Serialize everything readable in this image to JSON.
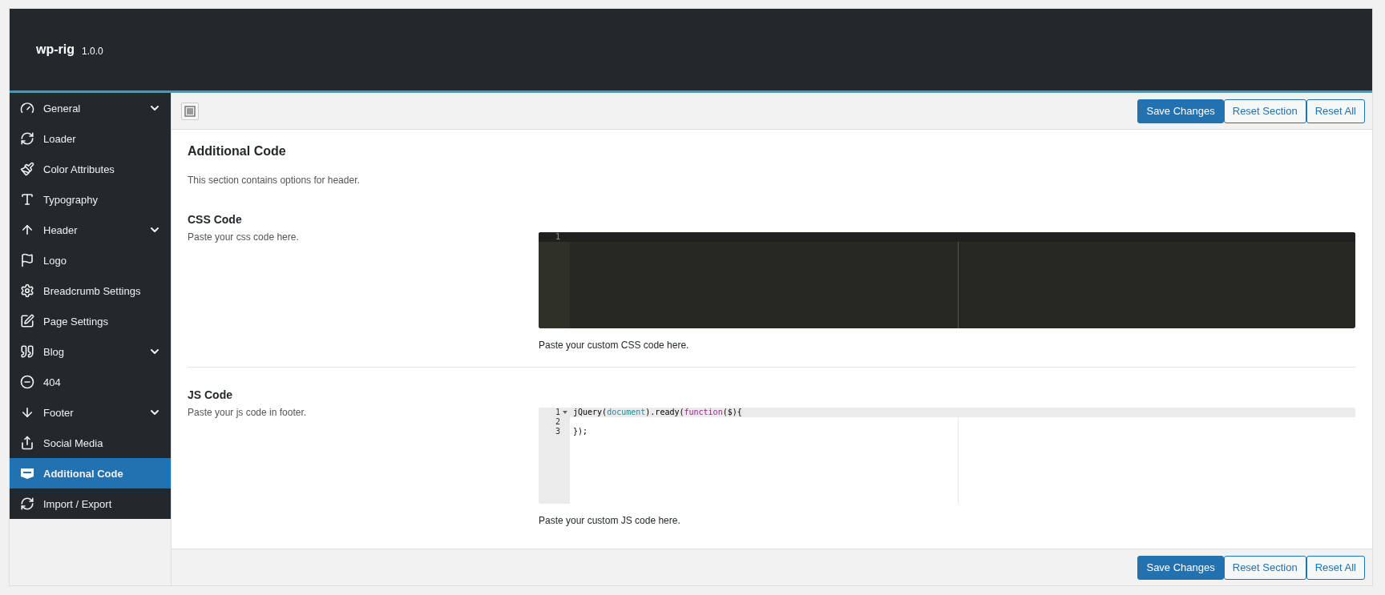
{
  "header": {
    "title": "wp-rig",
    "version": "1.0.0"
  },
  "sidebar": {
    "items": [
      {
        "label": "General",
        "expandable": true,
        "selected": false
      },
      {
        "label": "Loader",
        "expandable": false,
        "selected": false
      },
      {
        "label": "Color Attributes",
        "expandable": false,
        "selected": false
      },
      {
        "label": "Typography",
        "expandable": false,
        "selected": false
      },
      {
        "label": "Header",
        "expandable": true,
        "selected": false
      },
      {
        "label": "Logo",
        "expandable": false,
        "selected": false
      },
      {
        "label": "Breadcrumb Settings",
        "expandable": false,
        "selected": false
      },
      {
        "label": "Page Settings",
        "expandable": false,
        "selected": false
      },
      {
        "label": "Blog",
        "expandable": true,
        "selected": false
      },
      {
        "label": "404",
        "expandable": false,
        "selected": false
      },
      {
        "label": "Footer",
        "expandable": true,
        "selected": false
      },
      {
        "label": "Social Media",
        "expandable": false,
        "selected": false
      },
      {
        "label": "Additional Code",
        "expandable": false,
        "selected": true
      },
      {
        "label": "Import / Export",
        "expandable": false,
        "selected": false
      }
    ]
  },
  "toolbar": {
    "buttons": [
      {
        "label": "Save Changes",
        "kind": "primary"
      },
      {
        "label": "Reset Section",
        "kind": "secondary"
      },
      {
        "label": "Reset All",
        "kind": "secondary"
      }
    ]
  },
  "section": {
    "title": "Additional Code",
    "description": "This section contains options for header."
  },
  "fields": [
    {
      "title": "CSS Code",
      "description": "Paste your css code here.",
      "editor": {
        "kind": "dark",
        "lines": [
          {
            "number": "1",
            "active": true,
            "foldable": false
          }
        ]
      },
      "help": "Paste your custom CSS code here."
    },
    {
      "title": "JS Code",
      "description": "Paste your js code in footer.",
      "editor": {
        "kind": "light",
        "lines": [
          {
            "number": "1",
            "active": true,
            "foldable": true,
            "tokens": [
              {
                "text": "jQuery(",
                "kind": "plain"
              },
              {
                "text": "document",
                "kind": "variable"
              },
              {
                "text": ").ready(",
                "kind": "plain"
              },
              {
                "text": "function",
                "kind": "keyword"
              },
              {
                "text": "($){",
                "kind": "plain"
              }
            ]
          },
          {
            "number": "2",
            "active": false,
            "foldable": false
          },
          {
            "number": "3",
            "active": false,
            "foldable": false,
            "tokens": [
              {
                "text": "});",
                "kind": "plain"
              }
            ]
          }
        ]
      },
      "help": "Paste your custom JS code here."
    }
  ],
  "footer": {
    "buttons": [
      {
        "label": "Save Changes",
        "kind": "primary"
      },
      {
        "label": "Reset Section",
        "kind": "secondary"
      },
      {
        "label": "Reset All",
        "kind": "secondary"
      }
    ]
  }
}
